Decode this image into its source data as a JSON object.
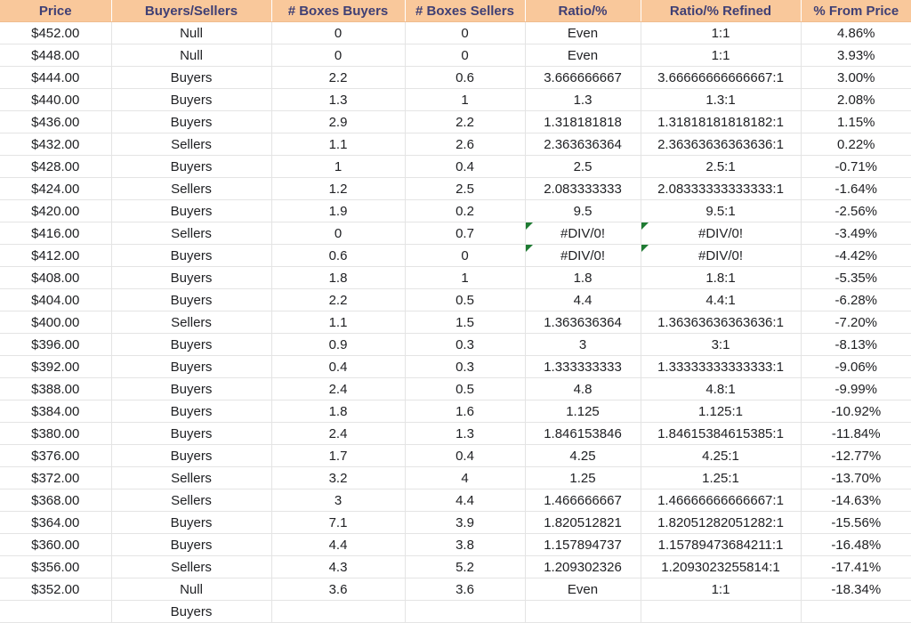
{
  "table": {
    "columns": [
      {
        "key": "price",
        "label": "Price"
      },
      {
        "key": "bs",
        "label": "Buyers/Sellers"
      },
      {
        "key": "boxbuy",
        "label": "# Boxes Buyers"
      },
      {
        "key": "boxsell",
        "label": "# Boxes Sellers"
      },
      {
        "key": "ratio",
        "label": "Ratio/%"
      },
      {
        "key": "ratioref",
        "label": "Ratio/% Refined"
      },
      {
        "key": "pct",
        "label": "% From Price"
      }
    ],
    "colors": {
      "header_bg": "#f9c89b",
      "header_text": "#3f3f74",
      "buyers_bg": "#c6e9cb",
      "buyers_text": "#1d6b24",
      "sellers_bg": "#facbd1",
      "sellers_text": "#cc2b40",
      "null_bg": "#fce8a0",
      "null_text": "#9a6a1a",
      "error_flag": "#1e7b32",
      "gridline": "#e4e4e4",
      "cell_text": "#202124"
    },
    "rows": [
      {
        "price": "$452.00",
        "bs": "Null",
        "boxbuy": "0",
        "boxsell": "0",
        "ratio": "Even",
        "ratioref": "1:1",
        "pct": "4.86%",
        "error": false
      },
      {
        "price": "$448.00",
        "bs": "Null",
        "boxbuy": "0",
        "boxsell": "0",
        "ratio": "Even",
        "ratioref": "1:1",
        "pct": "3.93%",
        "error": false
      },
      {
        "price": "$444.00",
        "bs": "Buyers",
        "boxbuy": "2.2",
        "boxsell": "0.6",
        "ratio": "3.666666667",
        "ratioref": "3.66666666666667:1",
        "pct": "3.00%",
        "error": false
      },
      {
        "price": "$440.00",
        "bs": "Buyers",
        "boxbuy": "1.3",
        "boxsell": "1",
        "ratio": "1.3",
        "ratioref": "1.3:1",
        "pct": "2.08%",
        "error": false
      },
      {
        "price": "$436.00",
        "bs": "Buyers",
        "boxbuy": "2.9",
        "boxsell": "2.2",
        "ratio": "1.318181818",
        "ratioref": "1.31818181818182:1",
        "pct": "1.15%",
        "error": false
      },
      {
        "price": "$432.00",
        "bs": "Sellers",
        "boxbuy": "1.1",
        "boxsell": "2.6",
        "ratio": "2.363636364",
        "ratioref": "2.36363636363636:1",
        "pct": "0.22%",
        "error": false
      },
      {
        "price": "$428.00",
        "bs": "Buyers",
        "boxbuy": "1",
        "boxsell": "0.4",
        "ratio": "2.5",
        "ratioref": "2.5:1",
        "pct": "-0.71%",
        "error": false
      },
      {
        "price": "$424.00",
        "bs": "Sellers",
        "boxbuy": "1.2",
        "boxsell": "2.5",
        "ratio": "2.083333333",
        "ratioref": "2.08333333333333:1",
        "pct": "-1.64%",
        "error": false
      },
      {
        "price": "$420.00",
        "bs": "Buyers",
        "boxbuy": "1.9",
        "boxsell": "0.2",
        "ratio": "9.5",
        "ratioref": "9.5:1",
        "pct": "-2.56%",
        "error": false
      },
      {
        "price": "$416.00",
        "bs": "Sellers",
        "boxbuy": "0",
        "boxsell": "0.7",
        "ratio": "#DIV/0!",
        "ratioref": "#DIV/0!",
        "pct": "-3.49%",
        "error": true
      },
      {
        "price": "$412.00",
        "bs": "Buyers",
        "boxbuy": "0.6",
        "boxsell": "0",
        "ratio": "#DIV/0!",
        "ratioref": "#DIV/0!",
        "pct": "-4.42%",
        "error": true
      },
      {
        "price": "$408.00",
        "bs": "Buyers",
        "boxbuy": "1.8",
        "boxsell": "1",
        "ratio": "1.8",
        "ratioref": "1.8:1",
        "pct": "-5.35%",
        "error": false
      },
      {
        "price": "$404.00",
        "bs": "Buyers",
        "boxbuy": "2.2",
        "boxsell": "0.5",
        "ratio": "4.4",
        "ratioref": "4.4:1",
        "pct": "-6.28%",
        "error": false
      },
      {
        "price": "$400.00",
        "bs": "Sellers",
        "boxbuy": "1.1",
        "boxsell": "1.5",
        "ratio": "1.363636364",
        "ratioref": "1.36363636363636:1",
        "pct": "-7.20%",
        "error": false
      },
      {
        "price": "$396.00",
        "bs": "Buyers",
        "boxbuy": "0.9",
        "boxsell": "0.3",
        "ratio": "3",
        "ratioref": "3:1",
        "pct": "-8.13%",
        "error": false
      },
      {
        "price": "$392.00",
        "bs": "Buyers",
        "boxbuy": "0.4",
        "boxsell": "0.3",
        "ratio": "1.333333333",
        "ratioref": "1.33333333333333:1",
        "pct": "-9.06%",
        "error": false
      },
      {
        "price": "$388.00",
        "bs": "Buyers",
        "boxbuy": "2.4",
        "boxsell": "0.5",
        "ratio": "4.8",
        "ratioref": "4.8:1",
        "pct": "-9.99%",
        "error": false
      },
      {
        "price": "$384.00",
        "bs": "Buyers",
        "boxbuy": "1.8",
        "boxsell": "1.6",
        "ratio": "1.125",
        "ratioref": "1.125:1",
        "pct": "-10.92%",
        "error": false
      },
      {
        "price": "$380.00",
        "bs": "Buyers",
        "boxbuy": "2.4",
        "boxsell": "1.3",
        "ratio": "1.846153846",
        "ratioref": "1.84615384615385:1",
        "pct": "-11.84%",
        "error": false
      },
      {
        "price": "$376.00",
        "bs": "Buyers",
        "boxbuy": "1.7",
        "boxsell": "0.4",
        "ratio": "4.25",
        "ratioref": "4.25:1",
        "pct": "-12.77%",
        "error": false
      },
      {
        "price": "$372.00",
        "bs": "Sellers",
        "boxbuy": "3.2",
        "boxsell": "4",
        "ratio": "1.25",
        "ratioref": "1.25:1",
        "pct": "-13.70%",
        "error": false
      },
      {
        "price": "$368.00",
        "bs": "Sellers",
        "boxbuy": "3",
        "boxsell": "4.4",
        "ratio": "1.466666667",
        "ratioref": "1.46666666666667:1",
        "pct": "-14.63%",
        "error": false
      },
      {
        "price": "$364.00",
        "bs": "Buyers",
        "boxbuy": "7.1",
        "boxsell": "3.9",
        "ratio": "1.820512821",
        "ratioref": "1.82051282051282:1",
        "pct": "-15.56%",
        "error": false
      },
      {
        "price": "$360.00",
        "bs": "Buyers",
        "boxbuy": "4.4",
        "boxsell": "3.8",
        "ratio": "1.157894737",
        "ratioref": "1.15789473684211:1",
        "pct": "-16.48%",
        "error": false
      },
      {
        "price": "$356.00",
        "bs": "Sellers",
        "boxbuy": "4.3",
        "boxsell": "5.2",
        "ratio": "1.209302326",
        "ratioref": "1.2093023255814:1",
        "pct": "-17.41%",
        "error": false
      },
      {
        "price": "$352.00",
        "bs": "Null",
        "boxbuy": "3.6",
        "boxsell": "3.6",
        "ratio": "Even",
        "ratioref": "1:1",
        "pct": "-18.34%",
        "error": false
      },
      {
        "price": "",
        "bs": "Buyers",
        "boxbuy": "",
        "boxsell": "",
        "ratio": "",
        "ratioref": "",
        "pct": "",
        "error": false
      }
    ]
  }
}
